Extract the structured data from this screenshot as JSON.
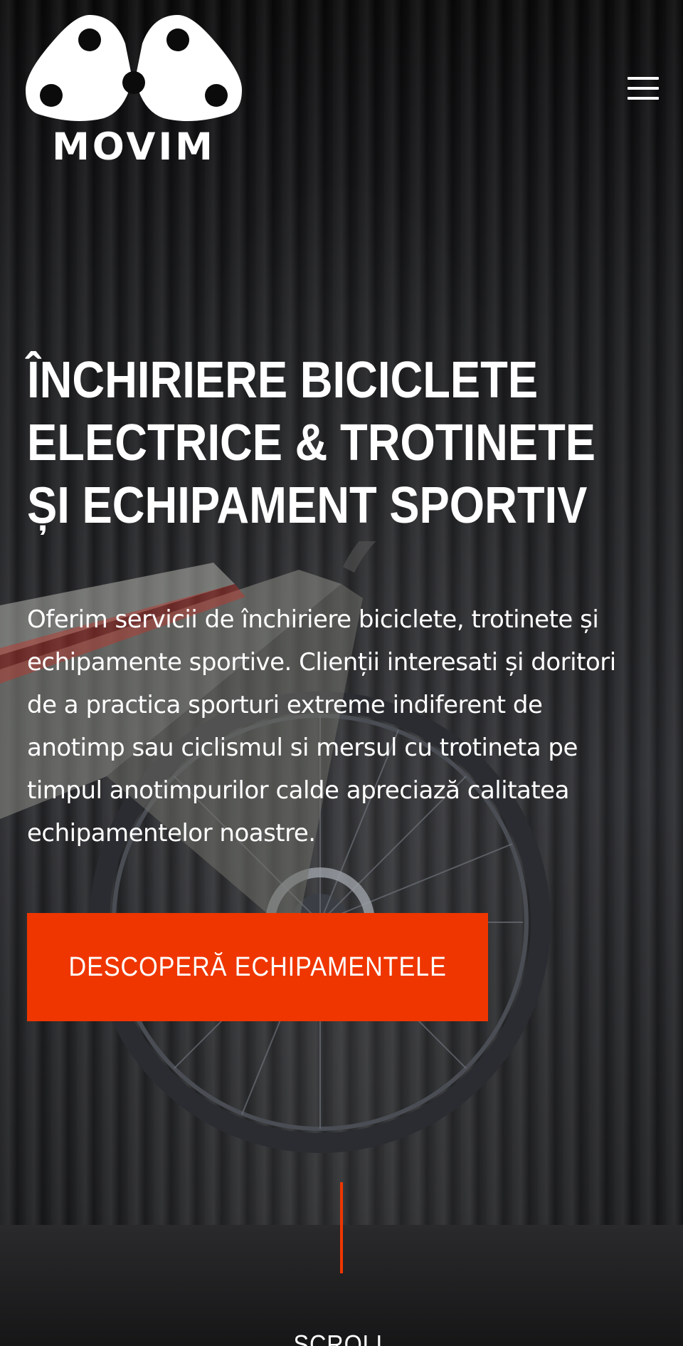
{
  "header": {
    "logo_text": "MOVIM",
    "menu_icon": "hamburger-menu-icon"
  },
  "hero": {
    "title": "ÎNCHIRIERE BICICLETE ELECTRICE & TROTINETE ȘI ECHIPAMENT SPORTIV",
    "description": "Oferim servicii de închiriere biciclete, trotinete și echipamente sportive. Clienții interesati și doritori de a practica sporturi extreme indiferent de anotimp sau ciclismul si mersul cu trotineta pe timpul anotimpurilor calde apreciază calitatea echipamentelor noastre.",
    "cta_label": "DESCOPERĂ ECHIPAMENTELE",
    "next_section_label": "SCROLL"
  },
  "colors": {
    "accent": "#ef3600",
    "background": "#0b0b0c",
    "text": "#ffffff"
  }
}
